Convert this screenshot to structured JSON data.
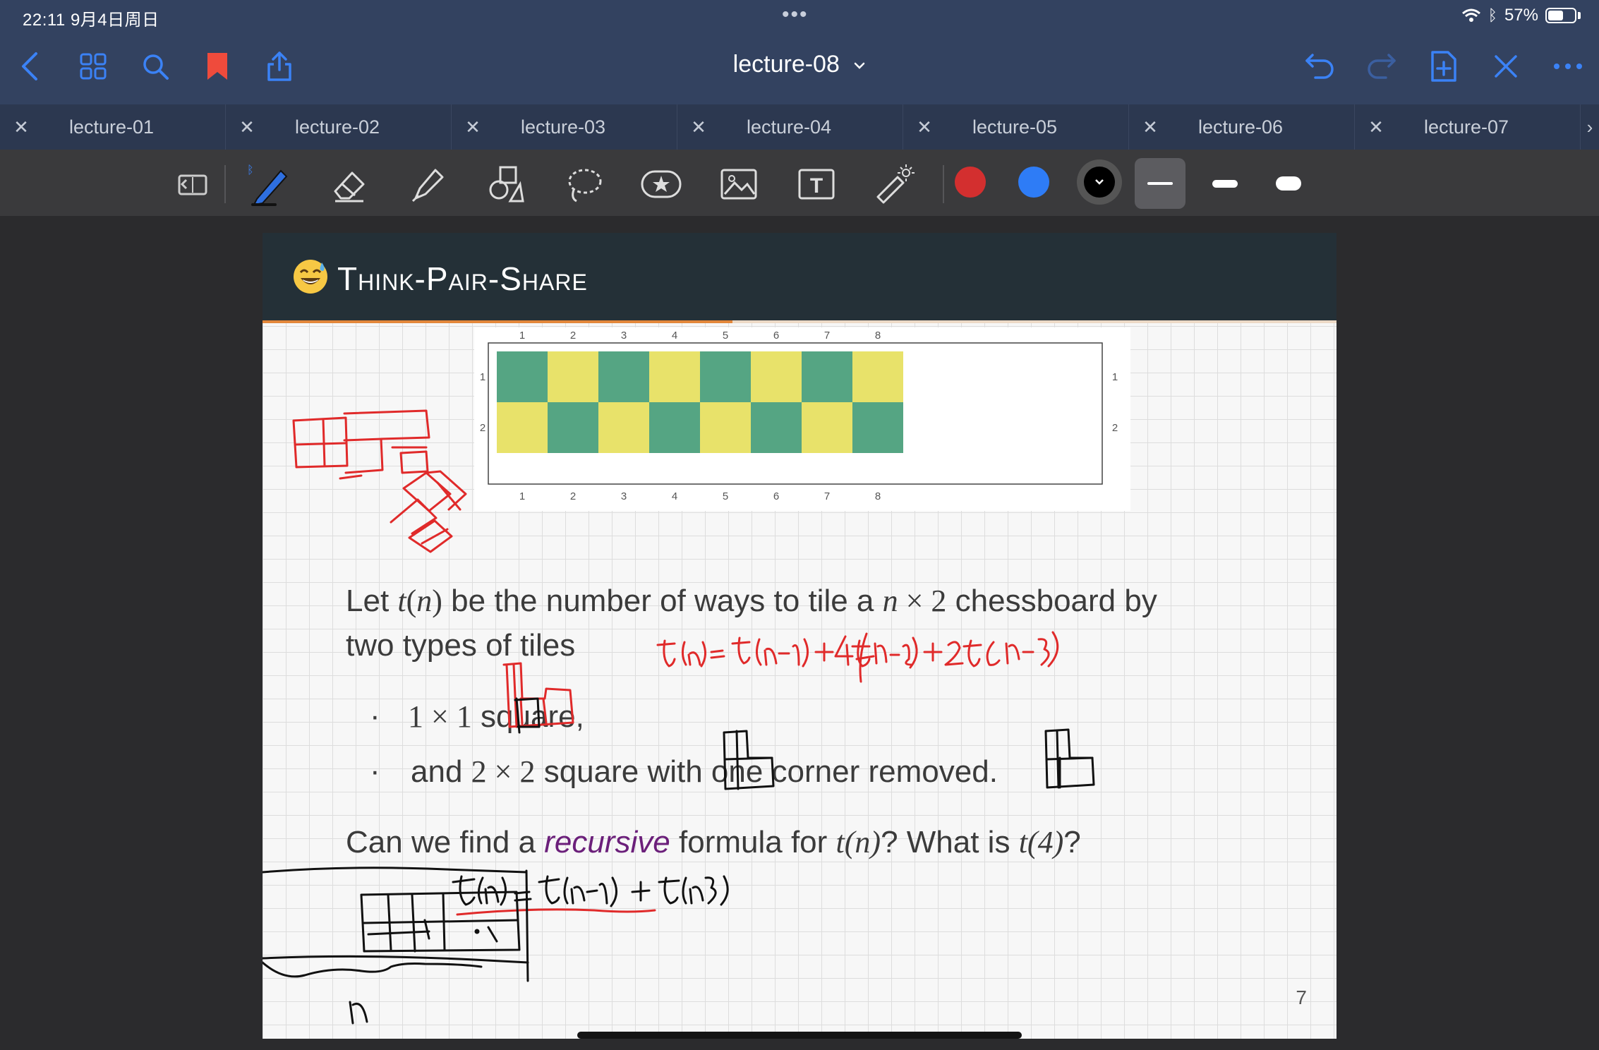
{
  "status_bar": {
    "time": "22:11  9月4日周日",
    "battery": "57%",
    "battery_level": 0.57
  },
  "header": {
    "title": "lecture-08",
    "title_chevron": "chevron-down-icon"
  },
  "tabs": [
    {
      "label": "lecture-01"
    },
    {
      "label": "lecture-02"
    },
    {
      "label": "lecture-03"
    },
    {
      "label": "lecture-04"
    },
    {
      "label": "lecture-05"
    },
    {
      "label": "lecture-06"
    },
    {
      "label": "lecture-07"
    }
  ],
  "toolbar": {
    "pen_colors": [
      "#d32f2f",
      "#2e7cf6",
      "#000000"
    ],
    "selected_color": "#000000"
  },
  "slide": {
    "title": "Think-Pair-Share",
    "line1_a": "Let ",
    "line1_t": "t",
    "line1_n_open": "(",
    "line1_n": "n",
    "line1_n_close": ")",
    "line1_b": " be the number of ways to tile a ",
    "line1_dim_n": "n",
    "line1_dim_rest": " × 2",
    "line1_c": " chessboard by",
    "line2": "two types of tiles",
    "bullet1_math": "1 × 1",
    "bullet1_text": " square,",
    "bullet2_a": "and ",
    "bullet2_math": "2 × 2",
    "bullet2_text": " square with one corner removed.",
    "question_a": "Can we find a ",
    "question_em": "recursive",
    "question_b": " formula for ",
    "question_t1": "t(n)",
    "question_c": "? What is ",
    "question_t2": "t(4)",
    "question_d": "?",
    "page_number": "7"
  },
  "chessboard": {
    "columns": 8,
    "rows": 2,
    "col_labels": [
      "1",
      "2",
      "3",
      "4",
      "5",
      "6",
      "7",
      "8"
    ],
    "row_labels": [
      "1",
      "2"
    ],
    "colors": {
      "green": "#55a583",
      "yellow": "#e8e26a"
    }
  },
  "colors": {
    "header_bg": "#334260",
    "accent_blue": "#2e7cf6",
    "bookmark_red": "#ef4b3c",
    "ink_red": "#e02a2a"
  }
}
